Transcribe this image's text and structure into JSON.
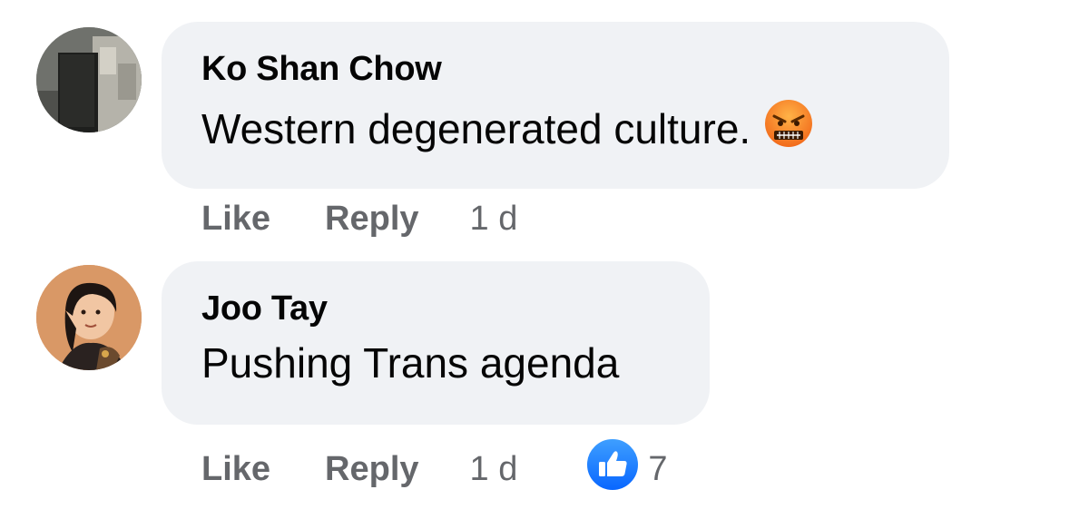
{
  "comments": [
    {
      "author": "Ko Shan Chow",
      "text": "Western degenerated culture.",
      "emoji": "angry-face-icon",
      "like_label": "Like",
      "reply_label": "Reply",
      "time": "1 d"
    },
    {
      "author": "Joo Tay",
      "text": "Pushing Trans agenda",
      "like_label": "Like",
      "reply_label": "Reply",
      "time": "1 d",
      "reaction_icon": "thumbs-up-icon",
      "reaction_count": "7"
    }
  ],
  "colors": {
    "bubble_bg": "#f0f2f5",
    "action_text": "#65676b",
    "like_blue": "#1877f2",
    "name_text": "#050505"
  }
}
